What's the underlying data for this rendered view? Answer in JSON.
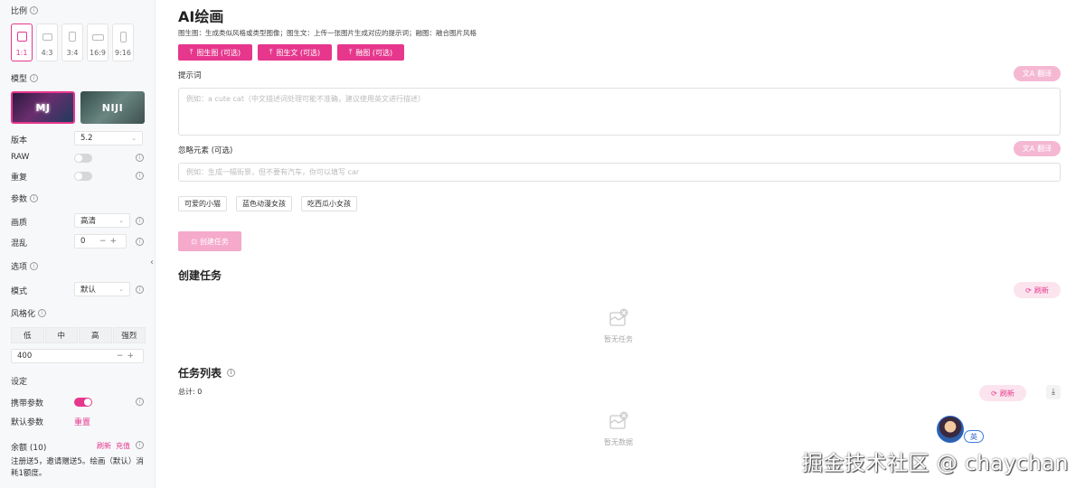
{
  "sidebar": {
    "ratio_title": "比例",
    "ratios": [
      {
        "label": "1:1",
        "active": true
      },
      {
        "label": "4:3",
        "active": false
      },
      {
        "label": "3:4",
        "active": false
      },
      {
        "label": "16:9",
        "active": false
      },
      {
        "label": "9:16",
        "active": false
      }
    ],
    "model_title": "模型",
    "models": [
      {
        "label": "MJ",
        "active": true
      },
      {
        "label": "NIJI",
        "active": false
      }
    ],
    "version_label": "版本",
    "version_value": "5.2",
    "raw_label": "RAW",
    "raw_on": false,
    "repeat_label": "重复",
    "repeat_on": false,
    "params_title": "参数",
    "quality_label": "画质",
    "quality_value": "高清",
    "chaos_label": "混乱",
    "chaos_value": "0",
    "options_title": "选项",
    "mode_label": "模式",
    "mode_value": "默认",
    "stylize_title": "风格化",
    "stylize_levels": [
      "低",
      "中",
      "高",
      "强烈"
    ],
    "stylize_value": "400",
    "settings_title": "设定",
    "carry_params_label": "携带参数",
    "carry_params_on": true,
    "default_params_label": "默认参数",
    "reset_label": "重置",
    "balance_label": "余额 (10)",
    "refresh_label": "刷新",
    "recharge_label": "充值",
    "note": "注册送5，邀请赠送5。绘画（默认）消耗1额度。"
  },
  "main": {
    "title": "AI绘画",
    "subtitle": "图生图：生成类似风格或类型图像；图生文：上传一张图片生成对应的提示词；融图：融合图片风格",
    "upload_buttons": [
      "图生图 (可选)",
      "图生文 (可选)",
      "融图 (可选)"
    ],
    "prompt_label": "提示词",
    "translate_label": "翻译",
    "prompt_placeholder": "例如：a cute cat（中文描述词处理可能不准确，建议使用英文进行描述）",
    "negative_label": "忽略元素 (可选)",
    "negative_placeholder": "例如：生成一幅街景，但不要有汽车，你可以填写 car",
    "chips": [
      "可爱的小猫",
      "蓝色动漫女孩",
      "吃西瓜小女孩"
    ],
    "create_button": "创建任务",
    "create_section_title": "创建任务",
    "refresh_label": "刷新",
    "empty_tasks": "暂无任务",
    "list_title": "任务列表",
    "total": "总计: 0",
    "empty_data": "暂无数据",
    "avatar_badge": "英",
    "watermark": "掘金技术社区 @ chaychan"
  },
  "colors": {
    "accent": "#e6378d",
    "accent_light": "#f5b8d3"
  }
}
